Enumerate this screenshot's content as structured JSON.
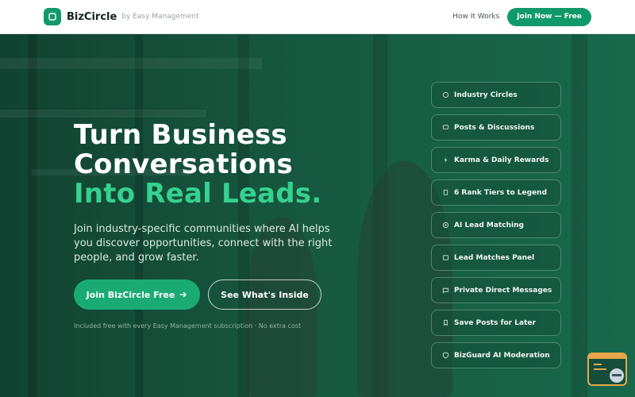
{
  "header": {
    "brand": "BizCircle",
    "byline": "by Easy Management",
    "nav_link": "How It Works",
    "join_button": "Join Now — Free"
  },
  "hero": {
    "title_line1": "Turn Business",
    "title_line2": "Conversations",
    "title_line3": "Into Real Leads.",
    "subtitle": "Join industry-specific communities where AI helps you discover opportunities, connect with the right people, and grow faster.",
    "primary_cta": "Join BizCircle Free",
    "secondary_cta": "See What's Inside",
    "note": "Included free with every Easy Management subscription · No extra cost"
  },
  "features": [
    {
      "label": "Industry Circles",
      "icon": "circles-icon"
    },
    {
      "label": "Posts & Discussions",
      "icon": "chat-icon"
    },
    {
      "label": "Karma & Daily Rewards",
      "icon": "bolt-icon"
    },
    {
      "label": "6 Rank Tiers to Legend",
      "icon": "trophy-icon"
    },
    {
      "label": "AI Lead Matching",
      "icon": "target-icon"
    },
    {
      "label": "Lead Matches Panel",
      "icon": "panel-icon"
    },
    {
      "label": "Private Direct Messages",
      "icon": "message-icon"
    },
    {
      "label": "Save Posts for Later",
      "icon": "bookmark-icon"
    },
    {
      "label": "BizGuard AI Moderation",
      "icon": "shield-icon"
    }
  ],
  "colors": {
    "accent": "#119a69",
    "highlight": "#35d190",
    "widget": "#e8a54b"
  }
}
